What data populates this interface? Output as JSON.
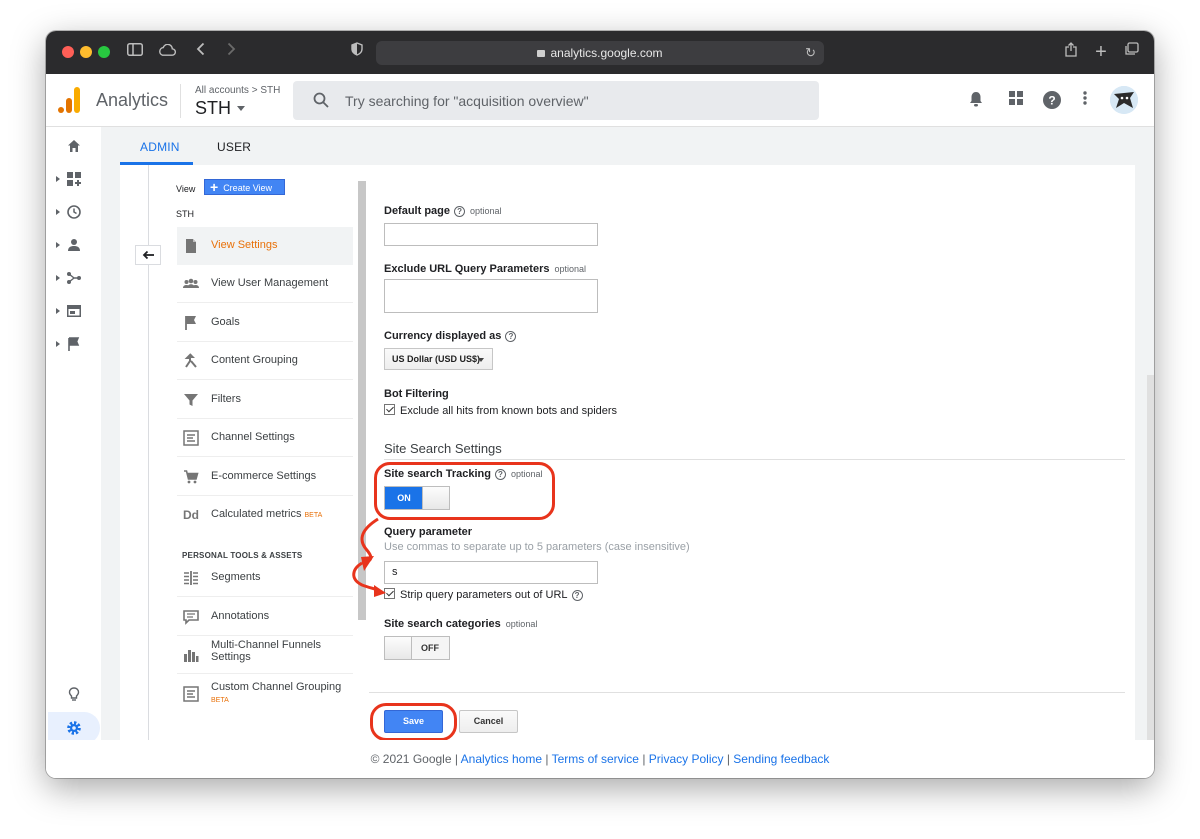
{
  "browser": {
    "url": "analytics.google.com"
  },
  "header": {
    "app_name": "Analytics",
    "breadcrumb": "All accounts > STH",
    "account": "STH",
    "search_placeholder": "Try searching for \"acquisition overview\""
  },
  "tabs": [
    {
      "label": "ADMIN",
      "active": true
    },
    {
      "label": "USER",
      "active": false
    }
  ],
  "nav": {
    "view_label": "View",
    "create_view": "Create View",
    "view_name": "STH",
    "items": [
      {
        "label": "View Settings",
        "active": true,
        "icon": "document-icon"
      },
      {
        "label": "View User Management",
        "icon": "people-icon"
      },
      {
        "label": "Goals",
        "icon": "flag-icon"
      },
      {
        "label": "Content Grouping",
        "icon": "grouping-icon"
      },
      {
        "label": "Filters",
        "icon": "filter-icon"
      },
      {
        "label": "Channel Settings",
        "icon": "channel-icon"
      },
      {
        "label": "E-commerce Settings",
        "icon": "cart-icon"
      },
      {
        "label": "Calculated metrics",
        "badge": "BETA",
        "icon": "dd-icon"
      }
    ],
    "section_header": "PERSONAL TOOLS & ASSETS",
    "tools": [
      {
        "label": "Segments",
        "icon": "segments-icon"
      },
      {
        "label": "Annotations",
        "icon": "annotation-icon"
      },
      {
        "label": "Multi-Channel Funnels Settings",
        "line1": "Multi-Channel Funnels",
        "line2": "Settings",
        "icon": "bar-chart-icon"
      },
      {
        "label": "Custom Channel Grouping",
        "badge": "BETA",
        "icon": "channel-icon"
      }
    ]
  },
  "form": {
    "default_page": {
      "label": "Default page",
      "optional": "optional",
      "value": ""
    },
    "exclude_params": {
      "label": "Exclude URL Query Parameters",
      "optional": "optional",
      "value": ""
    },
    "currency": {
      "label": "Currency displayed as",
      "value": "US Dollar (USD US$)"
    },
    "bot_filtering": {
      "label": "Bot Filtering",
      "checkbox": "Exclude all hits from known bots and spiders",
      "checked": true
    },
    "site_search_title": "Site Search Settings",
    "site_search_tracking": {
      "label": "Site search Tracking",
      "optional": "optional",
      "state": "ON"
    },
    "query_parameter": {
      "label": "Query parameter",
      "hint": "Use commas to separate up to 5 parameters (case insensitive)",
      "value": "s"
    },
    "strip_params": {
      "label": "Strip query parameters out of URL",
      "checked": true
    },
    "site_search_categories": {
      "label": "Site search categories",
      "optional": "optional",
      "state": "OFF"
    },
    "save": "Save",
    "cancel": "Cancel"
  },
  "footer": {
    "copyright": "© 2021 Google",
    "sep": "|",
    "links": [
      "Analytics home",
      "Terms of service",
      "Privacy Policy",
      "Sending feedback"
    ]
  },
  "colors": {
    "accent": "#1a73e8",
    "active_nav": "#e8710a",
    "annotation": "#e8341c"
  }
}
